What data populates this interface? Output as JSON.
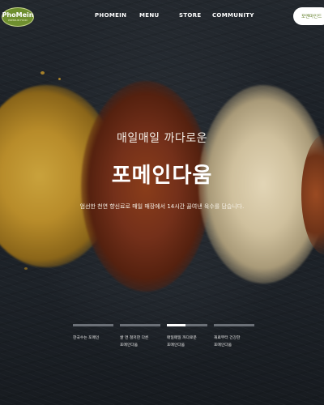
{
  "header": {
    "logo_text": "PhoMein",
    "logo_sub": "PREMIUM FOOD",
    "nav": [
      "PHOMEIN",
      "MENU",
      "STORE",
      "COMMUNITY"
    ],
    "cta_label": "포멘마인드"
  },
  "hero": {
    "eyebrow": "매일매일 까다로운",
    "title": "포메인다움",
    "description": "엄선한 천연 향신료로 매일 매장에서 14시간 끓여낸 육수를 담습니다."
  },
  "slides": [
    {
      "label_line1": "한국수는 포메인",
      "label_line2": "",
      "active": false
    },
    {
      "label_line1": "쌀 면 철저한 다른",
      "label_line2": "포메인다움",
      "active": false
    },
    {
      "label_line1": "매일매일 까다로운",
      "label_line2": "포메인다움",
      "active": true,
      "progress": 0.45
    },
    {
      "label_line1": "재료부터 건강한",
      "label_line2": "포메인다움",
      "active": false
    }
  ],
  "colors": {
    "brand_green": "#6f8f2f",
    "background": "#1c2127"
  }
}
